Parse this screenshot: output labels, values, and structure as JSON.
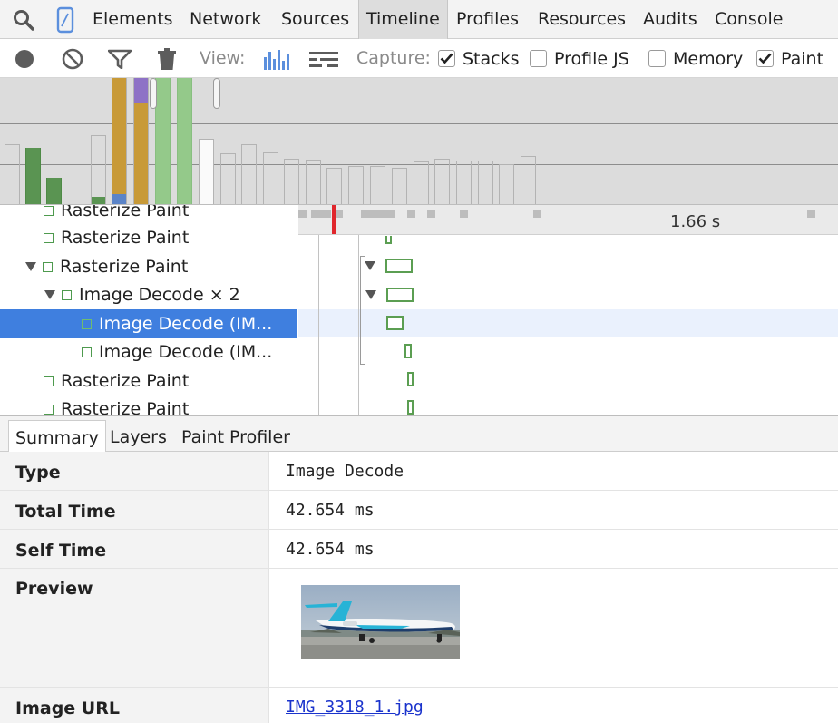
{
  "tabs": [
    {
      "id": "elements",
      "label": "Elements"
    },
    {
      "id": "network",
      "label": "Network"
    },
    {
      "id": "sources",
      "label": "Sources"
    },
    {
      "id": "timeline",
      "label": "Timeline",
      "selected": true
    },
    {
      "id": "profiles",
      "label": "Profiles"
    },
    {
      "id": "resources",
      "label": "Resources"
    },
    {
      "id": "audits",
      "label": "Audits"
    },
    {
      "id": "console",
      "label": "Console"
    }
  ],
  "toolbar": {
    "view_label": "View:",
    "capture_label": "Capture:",
    "checkboxes": [
      {
        "label": "Stacks",
        "checked": true
      },
      {
        "label": "Profile JS",
        "checked": false
      },
      {
        "label": "Memory",
        "checked": false
      },
      {
        "label": "Paint",
        "checked": true
      }
    ]
  },
  "tree": {
    "rows": [
      {
        "label": "Rasterize Paint",
        "expanded": null,
        "selected": false
      },
      {
        "label": "Rasterize Paint",
        "expanded": null,
        "selected": false
      },
      {
        "label": "Rasterize Paint",
        "expanded": true,
        "selected": false
      },
      {
        "label": "Image Decode × 2",
        "expanded": true,
        "selected": false
      },
      {
        "label": "Image Decode (IM...",
        "expanded": null,
        "selected": true
      },
      {
        "label": "Image Decode (IM...",
        "expanded": null,
        "selected": false
      },
      {
        "label": "Rasterize Paint",
        "expanded": null,
        "selected": false
      },
      {
        "label": "Rasterize Paint",
        "expanded": null,
        "selected": false
      }
    ]
  },
  "ruler": {
    "time_label": "1.66 s"
  },
  "bottom_tabs": [
    {
      "label": "Summary",
      "selected": true
    },
    {
      "label": "Layers",
      "selected": false
    },
    {
      "label": "Paint Profiler",
      "selected": false
    }
  ],
  "details": {
    "type_key": "Type",
    "type_value": "Image Decode",
    "total_key": "Total Time",
    "total_value": "42.654 ms",
    "self_key": "Self Time",
    "self_value": "42.654 ms",
    "preview_key": "Preview",
    "url_key": "Image URL",
    "url_value": "IMG_3318_1.jpg"
  },
  "colors": {
    "accent_selected": "#3f7fdf",
    "paint_green": "#5b9e52",
    "record_cursor": "#e0262c",
    "link": "#1a33cc"
  },
  "icons": {
    "search": "search-icon",
    "device": "device-mode-icon",
    "record": "record-icon",
    "clear": "clear-icon",
    "filter": "filter-icon",
    "garbage": "trash-icon",
    "bars_view": "bars-view-icon",
    "flame_view": "flame-view-icon"
  }
}
